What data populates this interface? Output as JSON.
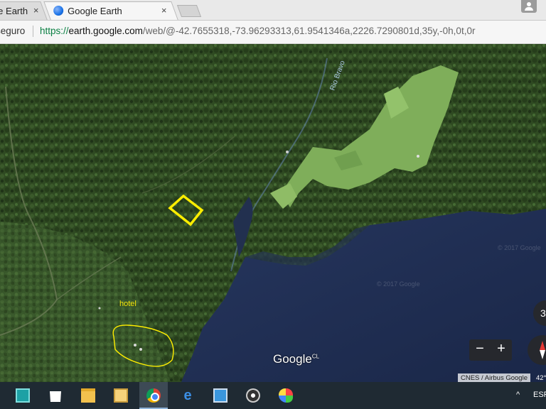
{
  "browser": {
    "tabs": [
      {
        "title": "e Earth",
        "close": "×",
        "active": false
      },
      {
        "title": "Google Earth",
        "close": "×",
        "active": true
      }
    ],
    "address": {
      "security_label": "seguro",
      "url_protocol": "https://",
      "url_host": "earth.google.com",
      "url_path": "/web/@-42.7655318,-73.96293313,61.9541346a,2226.7290801d,35y,-0h,0t,0r"
    }
  },
  "map": {
    "labels": {
      "hotel": "hotel",
      "river": "Rio Bravo",
      "watermark1": "© 2017 Google",
      "watermark2": "© 2017 Google"
    },
    "logo": "Google",
    "logo_region": "CL",
    "attribution": "CNES / Airbus  Google",
    "attribution_extra": "42°",
    "zoom_out": "−",
    "zoom_in": "+",
    "tilt_label": "3",
    "colors": {
      "forest": "#2f4a22",
      "forest_dark": "#1f3317",
      "pasture": "#7fae5a",
      "lake": "#1d2c52",
      "marker": "#ffee00",
      "hotel_outline": "#ffee00"
    }
  },
  "taskbar": {
    "items": [
      {
        "name": "app-icon",
        "active": false
      },
      {
        "name": "store-icon",
        "active": false
      },
      {
        "name": "file-explorer-icon",
        "active": false
      },
      {
        "name": "file-manager-icon",
        "active": false
      },
      {
        "name": "chrome-icon",
        "active": true
      },
      {
        "name": "edge-icon",
        "active": false
      },
      {
        "name": "contacts-icon",
        "active": false
      },
      {
        "name": "media-player-icon",
        "active": false
      },
      {
        "name": "paint-icon",
        "active": false
      }
    ],
    "tray_chevron": "^",
    "language": "ESP"
  }
}
